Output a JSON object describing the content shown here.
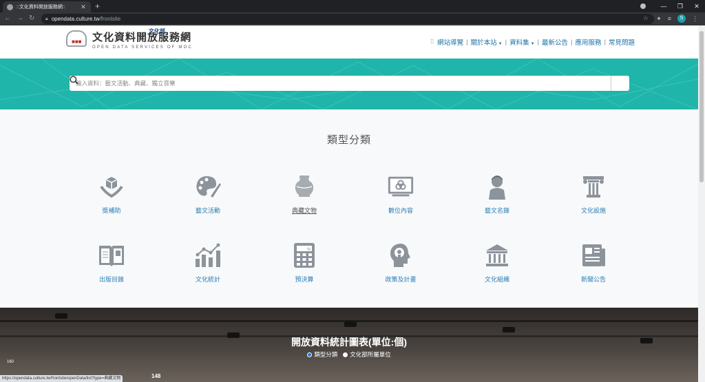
{
  "browser": {
    "tab_title": "::文化資料開放服務網::",
    "url_host": "opendata.culture.tw",
    "url_path": "/frontsite",
    "profile_initial": "S"
  },
  "header": {
    "logo_cn": "文化資料開放服務網",
    "logo_en": "OPEN DATA SERVICES OF MOC",
    "moc_badge": "文化部",
    "nav": [
      "網站導覽",
      "關於本站",
      "資料集",
      "最新公告",
      "應用服務",
      "常見問題"
    ]
  },
  "search": {
    "placeholder": "輸入資料：藝文活動、典藏、獨立音樂",
    "icon": "search-icon"
  },
  "categories": {
    "title": "類型分類",
    "items": [
      {
        "label": "獎補助",
        "icon": "grant-hands-icon"
      },
      {
        "label": "藝文活動",
        "icon": "palette-icon"
      },
      {
        "label": "典藏文物",
        "icon": "vase-icon"
      },
      {
        "label": "數位內容",
        "icon": "digital-screen-icon"
      },
      {
        "label": "藝文名錄",
        "icon": "person-icon"
      },
      {
        "label": "文化設施",
        "icon": "column-icon"
      },
      {
        "label": "出版目錄",
        "icon": "book-icon"
      },
      {
        "label": "文化統計",
        "icon": "chart-icon"
      },
      {
        "label": "預決算",
        "icon": "calculator-icon"
      },
      {
        "label": "政策及計畫",
        "icon": "idea-head-icon"
      },
      {
        "label": "文化組織",
        "icon": "institution-icon"
      },
      {
        "label": "新聞公告",
        "icon": "newspaper-icon"
      }
    ]
  },
  "stats": {
    "title": "開放資料統計圖表(單位:個)",
    "options": [
      "類型分類",
      "文化部所屬單位"
    ],
    "selected": 0,
    "y_tick": "160",
    "value_label": "148"
  },
  "statusbar": "https://opendata.culture.tw/frontsite/openData/list?type=典藏文物"
}
